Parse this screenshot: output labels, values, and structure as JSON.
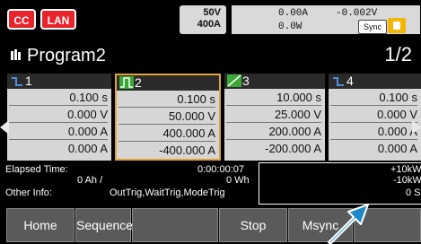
{
  "top": {
    "cc_label": "CC",
    "lan_label": "LAN",
    "rating_voltage": "50V",
    "rating_current": "400A",
    "current_reading": "0.00A",
    "voltage_reading": "-0.002V",
    "power_reading": "0.0W",
    "sync_label": "Sync"
  },
  "title": {
    "text": "Program2",
    "page": "1/2"
  },
  "steps": [
    {
      "num": "1",
      "time": "0.100 s",
      "voltage": "0.000 V",
      "current": "0.000 A",
      "current2": "0.000 A"
    },
    {
      "num": "2",
      "time": "0.100 s",
      "voltage": "50.000 V",
      "current": "400.000 A",
      "current2": "-400.000 A"
    },
    {
      "num": "3",
      "time": "10.000 s",
      "voltage": "25.000 V",
      "current": "200.000 A",
      "current2": "-200.000 A"
    },
    {
      "num": "4",
      "time": "0.100 s",
      "voltage": "0.000 V",
      "current": "0.000 A",
      "current2": "0.000 A"
    }
  ],
  "info": {
    "elapsed_label": "Elapsed Time:",
    "elapsed_value": "0:00:00:07",
    "ah_value": "0 Ah /",
    "wh_value": "0 Wh",
    "other_label": "Other Info:",
    "other_value": "OutTrig,WaitTrig,ModeTrig",
    "right1": "+10kW",
    "right2": "-10kW",
    "right3": "0 S"
  },
  "buttons": {
    "home": "Home",
    "sequence": "Sequence",
    "stop": "Stop",
    "msync": "Msync"
  },
  "colors": {
    "red_badge": "#e8242a",
    "highlight": "#e0a33a",
    "arrow": "#1e88c8",
    "lock": "#f2b705"
  }
}
